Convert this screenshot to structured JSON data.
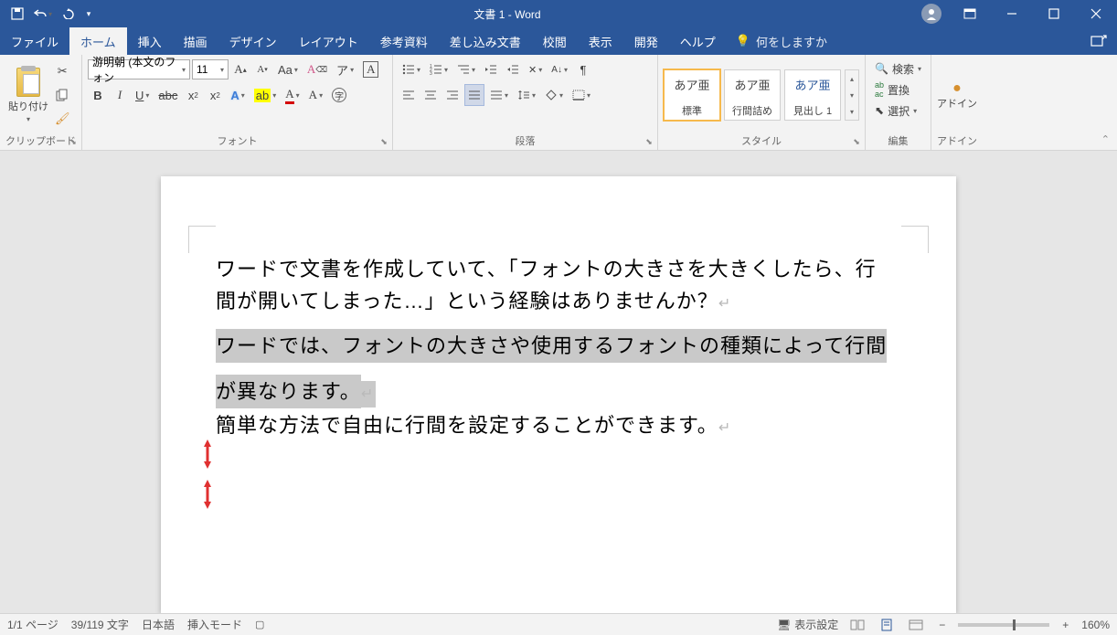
{
  "title": "文書 1  -  Word",
  "qat": {
    "save": "save",
    "undo": "undo",
    "redo": "redo"
  },
  "tabs": {
    "file": "ファイル",
    "home": "ホーム",
    "insert": "挿入",
    "draw": "描画",
    "design": "デザイン",
    "layout": "レイアウト",
    "references": "参考資料",
    "mailings": "差し込み文書",
    "review": "校閲",
    "view": "表示",
    "developer": "開発",
    "help": "ヘルプ"
  },
  "tell_me": "何をしますか",
  "ribbon": {
    "clipboard": {
      "paste": "貼り付け",
      "label": "クリップボード"
    },
    "font": {
      "name": "游明朝 (本文のフォン",
      "size": "11",
      "label": "フォント"
    },
    "paragraph": {
      "label": "段落"
    },
    "styles": {
      "label": "スタイル",
      "sample": "あア亜",
      "normal": "標準",
      "nospacing": "行間詰め",
      "heading1": "見出し 1"
    },
    "editing": {
      "find": "検索",
      "replace": "置換",
      "select": "選択",
      "label": "編集"
    },
    "addins": {
      "button": "アドイン",
      "label": "アドイン"
    }
  },
  "document": {
    "p1a": "ワードで文書を作成していて、「フォントの大きさを大きくしたら、行",
    "p1b": "間が開いてしまった…」という経験はありませんか？",
    "p2a": "ワードでは、フォントの大きさや使用するフォントの種類によって行間",
    "p2b": "が異なります。",
    "p3": "簡単な方法で自由に行間を設定することができます。"
  },
  "status": {
    "page": "1/1 ページ",
    "words": "39/119 文字",
    "lang": "日本語",
    "insert_mode": "挿入モード",
    "display_settings": "表示設定",
    "zoom": "160%"
  }
}
